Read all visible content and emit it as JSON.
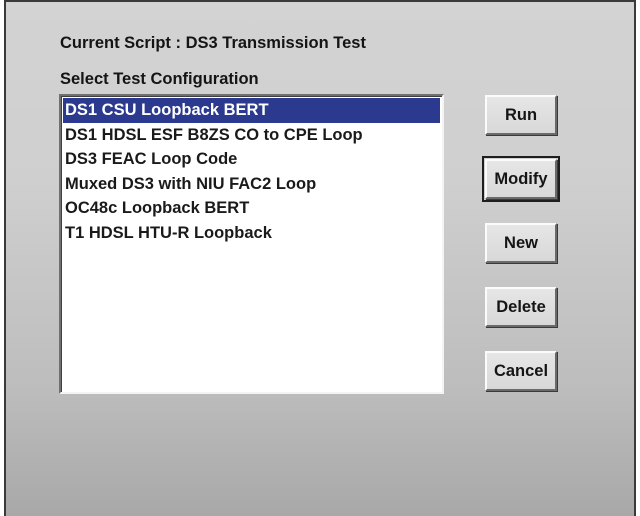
{
  "header": {
    "current_script": "Current Script : DS3 Transmission Test"
  },
  "config": {
    "label": "Select Test Configuration",
    "items": [
      {
        "label": "DS1 CSU Loopback BERT",
        "selected": true
      },
      {
        "label": "DS1 HDSL ESF B8ZS CO to CPE Loop",
        "selected": false
      },
      {
        "label": "DS3 FEAC Loop Code",
        "selected": false
      },
      {
        "label": "Muxed DS3 with NIU FAC2 Loop",
        "selected": false
      },
      {
        "label": "OC48c Loopback BERT",
        "selected": false
      },
      {
        "label": "T1 HDSL HTU-R Loopback",
        "selected": false
      }
    ],
    "selection_color": "#2b3a8f"
  },
  "buttons": {
    "run": "Run",
    "modify": "Modify",
    "new": "New",
    "delete": "Delete",
    "cancel": "Cancel"
  }
}
